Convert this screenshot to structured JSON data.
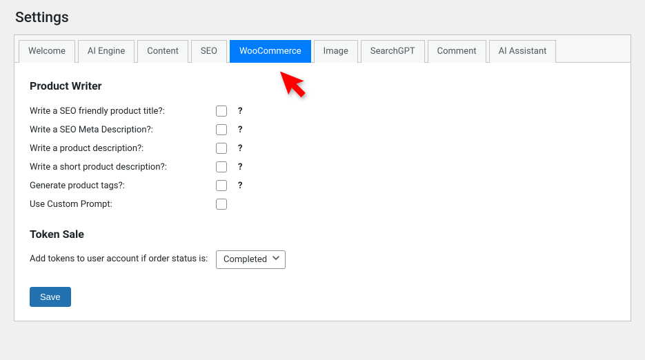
{
  "page_title": "Settings",
  "tabs": [
    {
      "label": "Welcome",
      "active": false
    },
    {
      "label": "AI Engine",
      "active": false
    },
    {
      "label": "Content",
      "active": false
    },
    {
      "label": "SEO",
      "active": false
    },
    {
      "label": "WooCommerce",
      "active": true
    },
    {
      "label": "Image",
      "active": false
    },
    {
      "label": "SearchGPT",
      "active": false
    },
    {
      "label": "Comment",
      "active": false
    },
    {
      "label": "AI Assistant",
      "active": false
    }
  ],
  "sections": {
    "product_writer": {
      "heading": "Product Writer",
      "fields": [
        {
          "label": "Write a SEO friendly product title?:",
          "has_help": true
        },
        {
          "label": "Write a SEO Meta Description?:",
          "has_help": true
        },
        {
          "label": "Write a product description?:",
          "has_help": true
        },
        {
          "label": "Write a short product description?:",
          "has_help": true
        },
        {
          "label": "Generate product tags?:",
          "has_help": true
        },
        {
          "label": "Use Custom Prompt:",
          "has_help": false
        }
      ]
    },
    "token_sale": {
      "heading": "Token Sale",
      "field_label": "Add tokens to user account if order status is:",
      "select_value": "Completed"
    }
  },
  "help_glyph": "?",
  "buttons": {
    "save": "Save"
  },
  "colors": {
    "accent": "#2271b1",
    "active_tab": "#007cff",
    "annotation_arrow": "#ff0000"
  }
}
